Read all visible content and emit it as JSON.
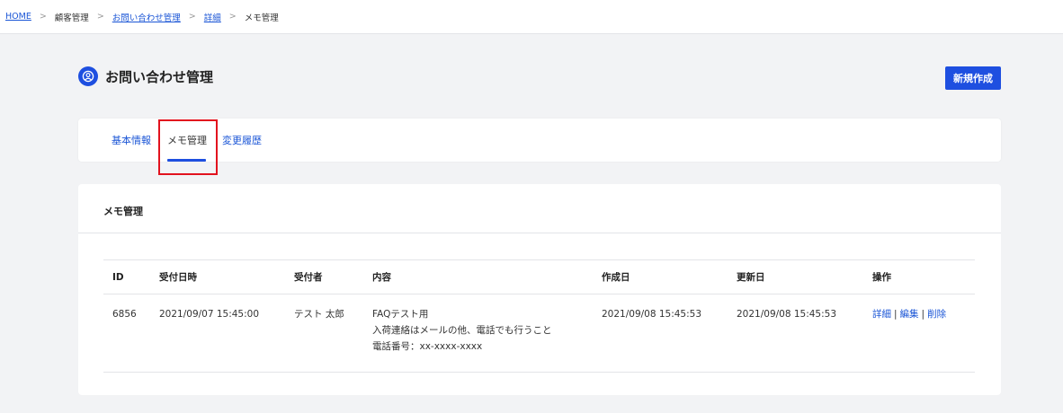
{
  "breadcrumb": {
    "home": "HOME",
    "customers": "顧客管理",
    "inquiries": "お問い合わせ管理",
    "detail": "詳細",
    "current": "メモ管理",
    "separator": ">"
  },
  "header": {
    "title": "お問い合わせ管理",
    "new_button": "新規作成"
  },
  "tabs": [
    {
      "label": "基本情報",
      "active": false
    },
    {
      "label": "メモ管理",
      "active": true
    },
    {
      "label": "変更履歴",
      "active": false
    }
  ],
  "memo_section": {
    "title": "メモ管理",
    "columns": [
      "ID",
      "受付日時",
      "受付者",
      "内容",
      "作成日",
      "更新日",
      "操作"
    ],
    "rows": [
      {
        "id": "6856",
        "received_at": "2021/09/07 15:45:00",
        "receiver": "テスト 太郎",
        "content": [
          "FAQテスト用",
          "入荷連絡はメールの他、電話でも行うこと",
          "電話番号：xx-xxxx-xxxx"
        ],
        "created": "2021/09/08 15:45:53",
        "updated": "2021/09/08 15:45:53",
        "actions": {
          "detail": "詳細",
          "edit": "編集",
          "delete": "削除",
          "separator": "|"
        }
      }
    ]
  },
  "colors": {
    "accent": "#1e4fe0",
    "link": "#1a55d6",
    "highlight": "#e2121e"
  },
  "icons": {
    "title_icon": "user-circle-icon"
  }
}
